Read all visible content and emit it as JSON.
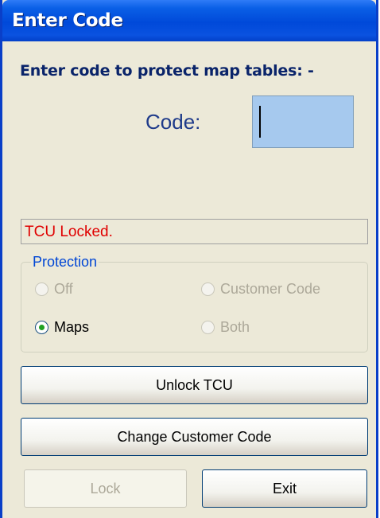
{
  "window": {
    "title": "Enter Code"
  },
  "prompt": "Enter code to protect map tables: -",
  "code": {
    "label": "Code:",
    "value": ""
  },
  "status": "TCU Locked.",
  "protection": {
    "legend": "Protection",
    "options": [
      {
        "label": "Off",
        "checked": false,
        "enabled": false
      },
      {
        "label": "Customer Code",
        "checked": false,
        "enabled": false
      },
      {
        "label": "Maps",
        "checked": true,
        "enabled": true
      },
      {
        "label": "Both",
        "checked": false,
        "enabled": false
      }
    ]
  },
  "buttons": {
    "unlock": "Unlock TCU",
    "change_code": "Change Customer Code",
    "lock": "Lock",
    "exit": "Exit"
  },
  "colors": {
    "titlebar": "#0049D9",
    "prompt_text": "#0A246A",
    "status_text": "#E00000",
    "input_bg": "#A6C9EE",
    "window_bg": "#ECE9D8"
  }
}
